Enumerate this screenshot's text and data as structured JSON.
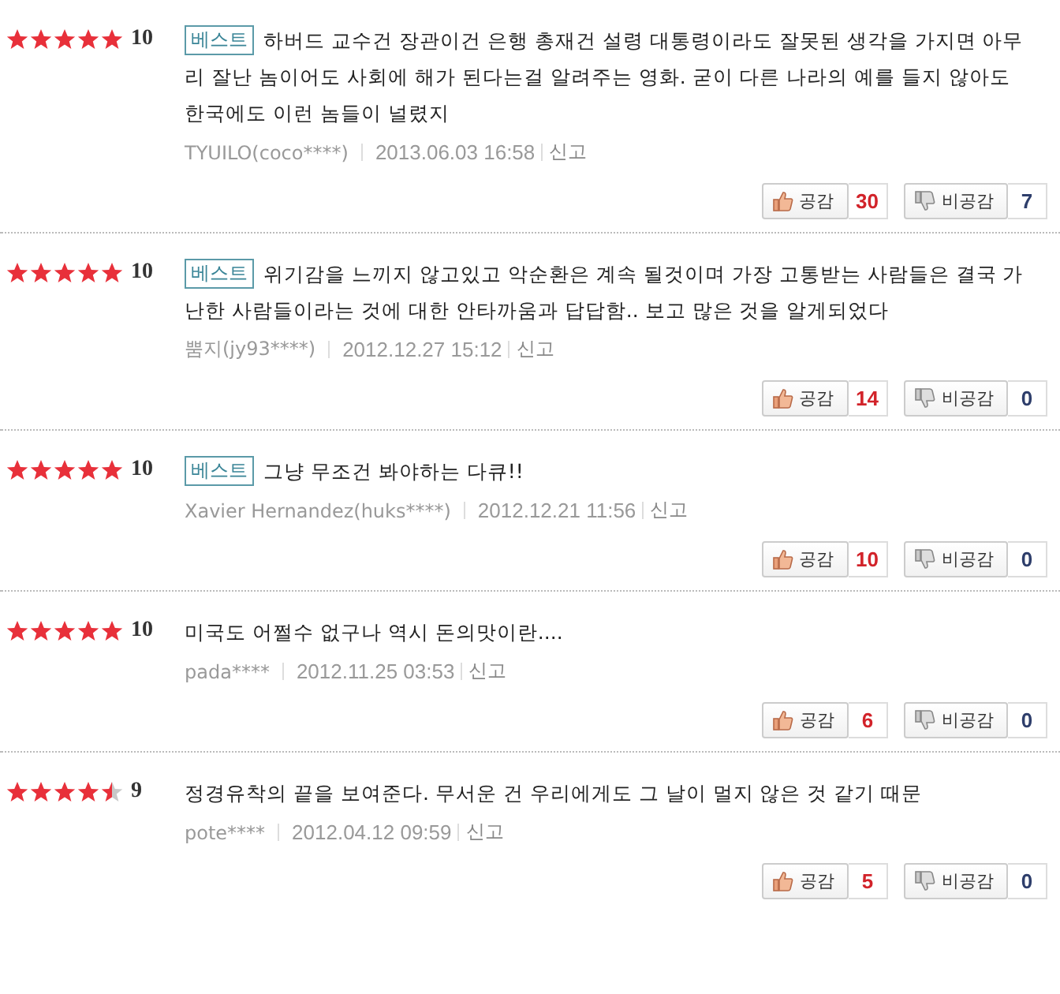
{
  "reviews": [
    {
      "stars": 5,
      "score": "10",
      "badge": "베스트",
      "text": "하버드 교수건 장관이건 은행 총재건 설령 대통령이라도 잘못된 생각을 가지면 아무리 잘난 놈이어도 사회에 해가 된다는걸 알려주는 영화. 굳이 다른 나라의 예를 들지 않아도 한국에도 이런 놈들이 널렸지",
      "author": "TYUILO(coco****)",
      "date": "2013.06.03 16:58",
      "report": "신고",
      "like_label": "공감",
      "likes": "30",
      "dislike_label": "비공감",
      "dislikes": "7"
    },
    {
      "stars": 5,
      "score": "10",
      "badge": "베스트",
      "text": "위기감을 느끼지 않고있고 악순환은 계속 될것이며 가장 고통받는 사람들은 결국 가난한 사람들이라는 것에 대한 안타까움과 답답함.. 보고 많은 것을 알게되었다",
      "author": "뿜지(jy93****)",
      "date": "2012.12.27 15:12",
      "report": "신고",
      "like_label": "공감",
      "likes": "14",
      "dislike_label": "비공감",
      "dislikes": "0"
    },
    {
      "stars": 5,
      "score": "10",
      "badge": "베스트",
      "text": "그냥 무조건 봐야하는 다큐!!",
      "author": "Xavier Hernandez(huks****)",
      "date": "2012.12.21 11:56",
      "report": "신고",
      "like_label": "공감",
      "likes": "10",
      "dislike_label": "비공감",
      "dislikes": "0"
    },
    {
      "stars": 5,
      "score": "10",
      "text": "미국도 어쩔수 없구나 역시 돈의맛이란....",
      "author": "pada****",
      "date": "2012.11.25 03:53",
      "report": "신고",
      "like_label": "공감",
      "likes": "6",
      "dislike_label": "비공감",
      "dislikes": "0"
    },
    {
      "stars": 4.5,
      "score": "9",
      "text": "정경유착의 끝을 보여준다. 무서운 건 우리에게도 그 날이 멀지 않은 것 같기 때문",
      "author": "pote****",
      "date": "2012.04.12 09:59",
      "report": "신고",
      "like_label": "공감",
      "likes": "5",
      "dislike_label": "비공감",
      "dislikes": "0"
    }
  ]
}
